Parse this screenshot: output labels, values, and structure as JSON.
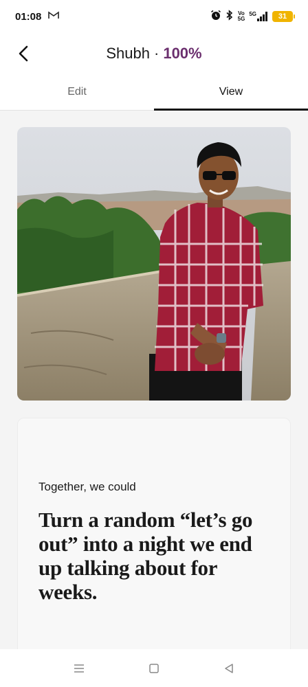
{
  "status_bar": {
    "time": "01:08",
    "mail_icon": "gmail-icon",
    "battery_level": "31",
    "network": "5G",
    "volte_label": "Vo",
    "volte_sub": "5G"
  },
  "header": {
    "name": "Shubh",
    "separator": "·",
    "completion": "100%",
    "back_icon": "chevron-left-icon"
  },
  "tabs": [
    {
      "label": "Edit",
      "active": false
    },
    {
      "label": "View",
      "active": true
    }
  ],
  "photo": {
    "icon": "profile-photo"
  },
  "prompt": {
    "label": "Together, we could",
    "answer": "Turn a random “let’s go out” into a night we end up talking about for weeks."
  },
  "nav": {
    "menu_icon": "menu-icon",
    "home_icon": "square-home-icon",
    "back_icon": "triangle-back-icon"
  },
  "colors": {
    "accent": "#6b2f6e",
    "battery": "#f0b400"
  }
}
